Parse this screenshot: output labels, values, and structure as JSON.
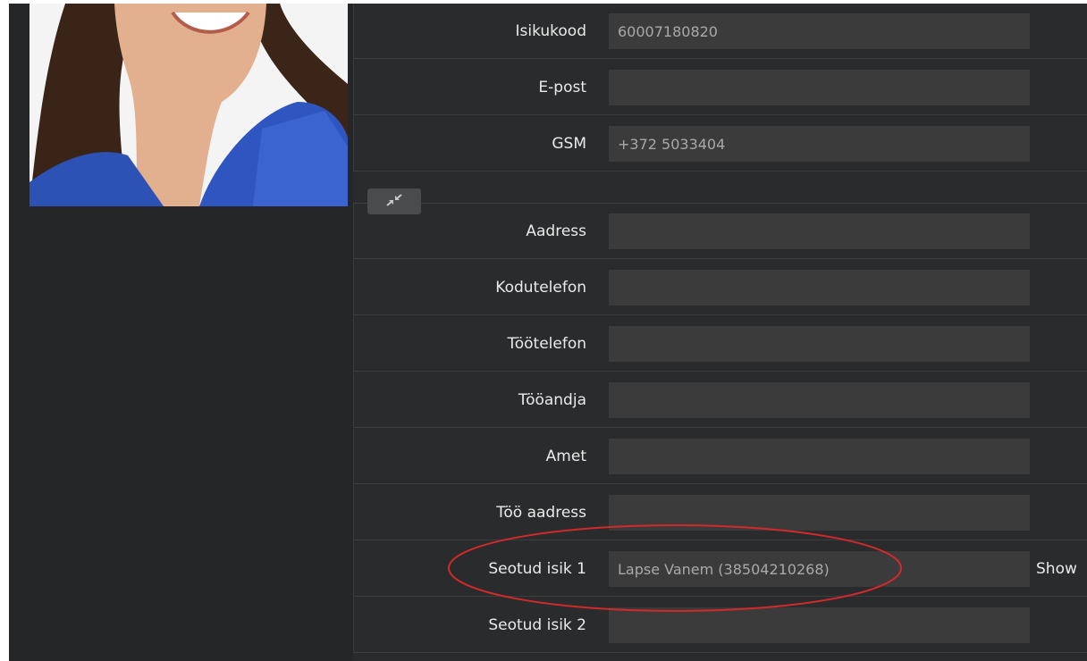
{
  "profile": {
    "photo_alt": ""
  },
  "fields": [
    {
      "key": "isikukood",
      "label": "Isikukood",
      "value": "60007180820"
    },
    {
      "key": "epost",
      "label": "E-post",
      "value": ""
    },
    {
      "key": "gsm",
      "label": "GSM",
      "value": "+372 5033404"
    },
    {
      "key": "aadress",
      "label": "Aadress",
      "value": ""
    },
    {
      "key": "kodutelefon",
      "label": "Kodutelefon",
      "value": ""
    },
    {
      "key": "tootelefon",
      "label": "Töötelefon",
      "value": ""
    },
    {
      "key": "tooandja",
      "label": "Tööandja",
      "value": ""
    },
    {
      "key": "amet",
      "label": "Amet",
      "value": ""
    },
    {
      "key": "too_aadress",
      "label": "Töö aadress",
      "value": ""
    },
    {
      "key": "seotud_isik_1",
      "label": "Seotud isik 1",
      "value": "Lapse Vanem (38504210268)"
    },
    {
      "key": "seotud_isik_2",
      "label": "Seotud isik 2",
      "value": ""
    }
  ],
  "show_link": "Show",
  "icons": {
    "collapse": "compress-arrows-icon"
  },
  "colors": {
    "background": "#252627",
    "field": "#3b3b3c",
    "highlight": "#d12a2a"
  }
}
